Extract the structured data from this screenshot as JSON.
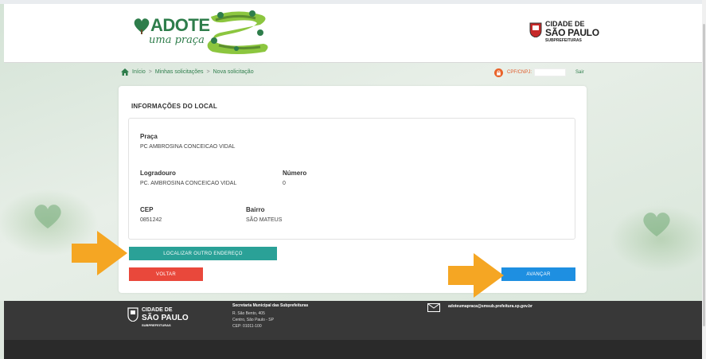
{
  "header": {
    "logo_word": "ADOTE",
    "logo_sub": "uma praça",
    "city_logo": {
      "line1": "CIDADE DE",
      "line2": "SÃO PAULO",
      "line3": "SUBPREFEITURAS"
    }
  },
  "breadcrumb": {
    "home": "Início",
    "sep1": ">",
    "item1": "Minhas solicitações",
    "sep2": ">",
    "item2": "Nova solicitação"
  },
  "user": {
    "cpf_label": "CPF/CNPJ:",
    "cpf_value": "",
    "logout": "Sair"
  },
  "card": {
    "title": "INFORMAÇÕES DO LOCAL",
    "praca_label": "Praça",
    "praca_value": "PC AMBROSINA CONCEICAO VIDAL",
    "logradouro_label": "Logradouro",
    "logradouro_value": "PC. AMBROSINA CONCEICAO VIDAL",
    "numero_label": "Número",
    "numero_value": "0",
    "cep_label": "CEP",
    "cep_value": "0851242",
    "bairro_label": "Bairro",
    "bairro_value": "SÃO MATEUS"
  },
  "buttons": {
    "localizar": "LOCALIZAR OUTRO ENDEREÇO",
    "voltar": "VOLTAR",
    "avancar": "AVANÇAR"
  },
  "footer": {
    "logo_line1": "CIDADE DE",
    "logo_line2": "SÃO PAULO",
    "logo_line3": "SUBPREFEITURAS",
    "org": "Secretaria Municipal das Subprefeituras",
    "address1": "R. São Bento, 405",
    "address2": "Centro, São Paulo - SP",
    "cep": "CEP: 01011-100",
    "email": "adoteumapraca@smsub.prefeitura.sp.gov.br"
  },
  "colors": {
    "brand_green": "#2e7d4b",
    "teal_button": "#2aa197",
    "red_button": "#e9483b",
    "blue_button": "#1e8fe1",
    "arrow_orange": "#f5a623",
    "footer_bg": "#383838"
  },
  "icons": [
    "home-icon",
    "lock-icon",
    "mail-icon",
    "arrow-annotation-icon",
    "heart-logo-icon",
    "city-emblem-icon"
  ]
}
